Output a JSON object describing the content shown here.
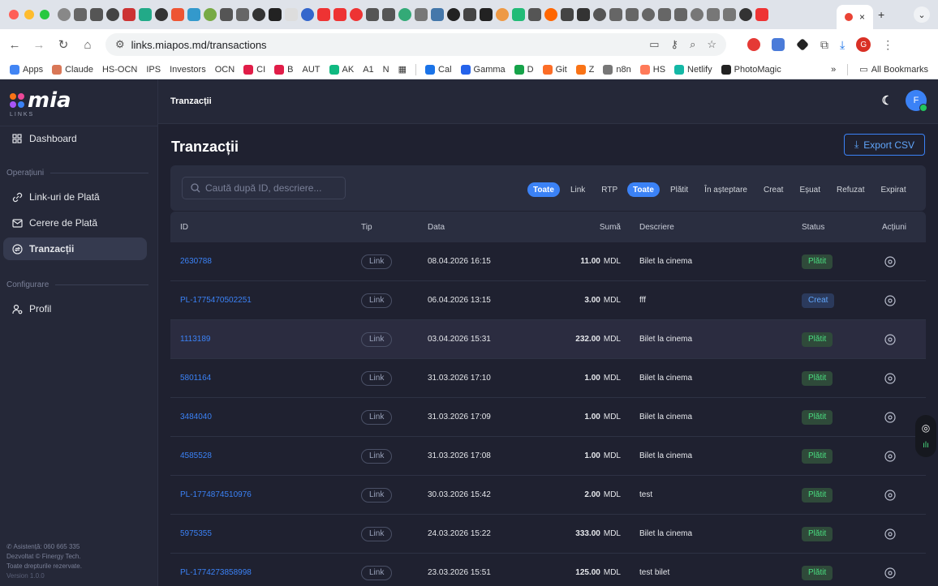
{
  "browser": {
    "tab_close": "×",
    "new_tab": "+",
    "url": "links.miapos.md/transactions",
    "bookmarks": [
      "Apps",
      "Claude",
      "HS-OCN",
      "IPS",
      "Investors",
      "OCN",
      "CI",
      "B",
      "AUT",
      "AK",
      "A1",
      "N",
      "Cal",
      "Gamma",
      "D",
      "Git",
      "Z",
      "n8n",
      "HS",
      "Netlify",
      "PhotoMagic"
    ],
    "all_bookmarks": "All Bookmarks",
    "more": "»"
  },
  "sidebar": {
    "logo_text": "mia",
    "logo_sub": "LINKS",
    "dashboard": "Dashboard",
    "section_operations": "Operațiuni",
    "items": [
      "Link-uri de Plată",
      "Cerere de Plată",
      "Tranzacții"
    ],
    "section_config": "Configurare",
    "profile": "Profil",
    "footer_support": "Asistență: 060 665 335",
    "footer_dev": "Dezvoltat © Finergy Tech.",
    "footer_rights": "Toate drepturile rezervate.",
    "footer_version": "Version 1.0.0"
  },
  "topbar": {
    "breadcrumb": "Tranzacții",
    "avatar": "F"
  },
  "main": {
    "title": "Tranzacții",
    "export_label": "Export CSV",
    "search_placeholder": "Caută după ID, descriere...",
    "type_filters": [
      "Toate",
      "Link",
      "RTP"
    ],
    "status_filters": [
      "Toate",
      "Plătit",
      "În așteptare",
      "Creat",
      "Eșuat",
      "Refuzat",
      "Expirat"
    ]
  },
  "table": {
    "columns": [
      "ID",
      "Tip",
      "Data",
      "Sumă",
      "Descriere",
      "Status",
      "Acțiuni"
    ],
    "currency": "MDL",
    "rows": [
      {
        "id": "2630788",
        "tip": "Link",
        "data": "08.04.2026 16:15",
        "suma": "11.00",
        "descriere": "Bilet la cinema",
        "status": "Plătit"
      },
      {
        "id": "PL-1775470502251",
        "tip": "Link",
        "data": "06.04.2026 13:15",
        "suma": "3.00",
        "descriere": "fff",
        "status": "Creat"
      },
      {
        "id": "1113189",
        "tip": "Link",
        "data": "03.04.2026 15:31",
        "suma": "232.00",
        "descriere": "Bilet la cinema",
        "status": "Plătit"
      },
      {
        "id": "5801164",
        "tip": "Link",
        "data": "31.03.2026 17:10",
        "suma": "1.00",
        "descriere": "Bilet la cinema",
        "status": "Plătit"
      },
      {
        "id": "3484040",
        "tip": "Link",
        "data": "31.03.2026 17:09",
        "suma": "1.00",
        "descriere": "Bilet la cinema",
        "status": "Plătit"
      },
      {
        "id": "4585528",
        "tip": "Link",
        "data": "31.03.2026 17:08",
        "suma": "1.00",
        "descriere": "Bilet la cinema",
        "status": "Plătit"
      },
      {
        "id": "PL-1774874510976",
        "tip": "Link",
        "data": "30.03.2026 15:42",
        "suma": "2.00",
        "descriere": "test",
        "status": "Plătit"
      },
      {
        "id": "5975355",
        "tip": "Link",
        "data": "24.03.2026 15:22",
        "suma": "333.00",
        "descriere": "Bilet la cinema",
        "status": "Plătit"
      },
      {
        "id": "PL-1774273858998",
        "tip": "Link",
        "data": "23.03.2026 15:51",
        "suma": "125.00",
        "descriere": "test bilet",
        "status": "Plătit"
      }
    ]
  }
}
